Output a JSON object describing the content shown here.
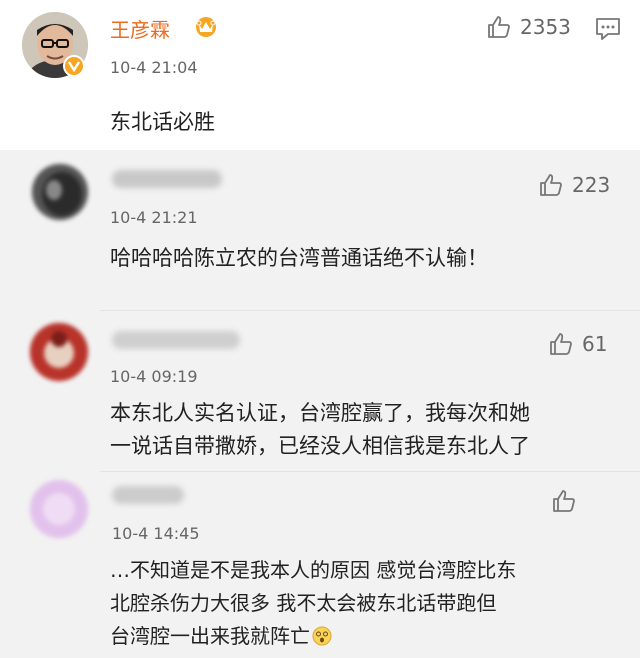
{
  "main_comment": {
    "author": "王彦霖",
    "time": "10-4 21:04",
    "likes": "2353",
    "text": "东北话必胜",
    "icons": {
      "badge": "crown-icon",
      "verified": "verified-v-icon",
      "like": "thumbs-up-icon",
      "comment": "comment-icon"
    }
  },
  "replies": [
    {
      "time": "10-4 21:21",
      "likes": "223",
      "text": "哈哈哈哈陈立农的台湾普通话绝不认输！"
    },
    {
      "time": "10-4 09:19",
      "likes": "61",
      "text_lines": [
        "本东北人实名认证，台湾腔赢了，我每次和她",
        "一说话自带撒娇，已经没人相信我是东北人了"
      ]
    },
    {
      "time": "10-4 14:45",
      "likes": "",
      "text_lines": [
        "…不知道是不是我本人的原因 感觉台湾腔比东",
        "北腔杀伤力大很多 我不太会被东北话带跑但",
        "台湾腔一出来我就阵亡"
      ],
      "emoji": "emoji-dizzy-face"
    }
  ],
  "colors": {
    "name_orange": "#f06a1b",
    "reply_bg": "#f2f2f2",
    "text_dark": "#222222",
    "text_gray": "#666666"
  }
}
